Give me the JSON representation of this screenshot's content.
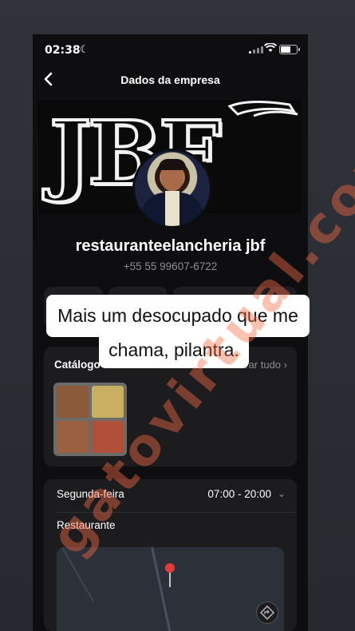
{
  "status_bar": {
    "time": "02:38"
  },
  "nav": {
    "title": "Dados da empresa"
  },
  "cover": {
    "text": "JBF"
  },
  "business": {
    "name": "restauranteelancheria jbf",
    "phone": "+55 55 99607-6722"
  },
  "caption": {
    "line1": "Mais um desocupado que me",
    "line2": "chama, pilantra."
  },
  "catalog": {
    "title": "Catálogo",
    "see_all": "Mostrar tudo"
  },
  "hours": {
    "day": "Segunda-feira",
    "time": "07:00 - 20:00"
  },
  "category": "Restaurante",
  "watermark": "gatovirtual.com",
  "colors": {
    "accent_watermark": "#ff6e46",
    "pin": "#e23a3a"
  }
}
